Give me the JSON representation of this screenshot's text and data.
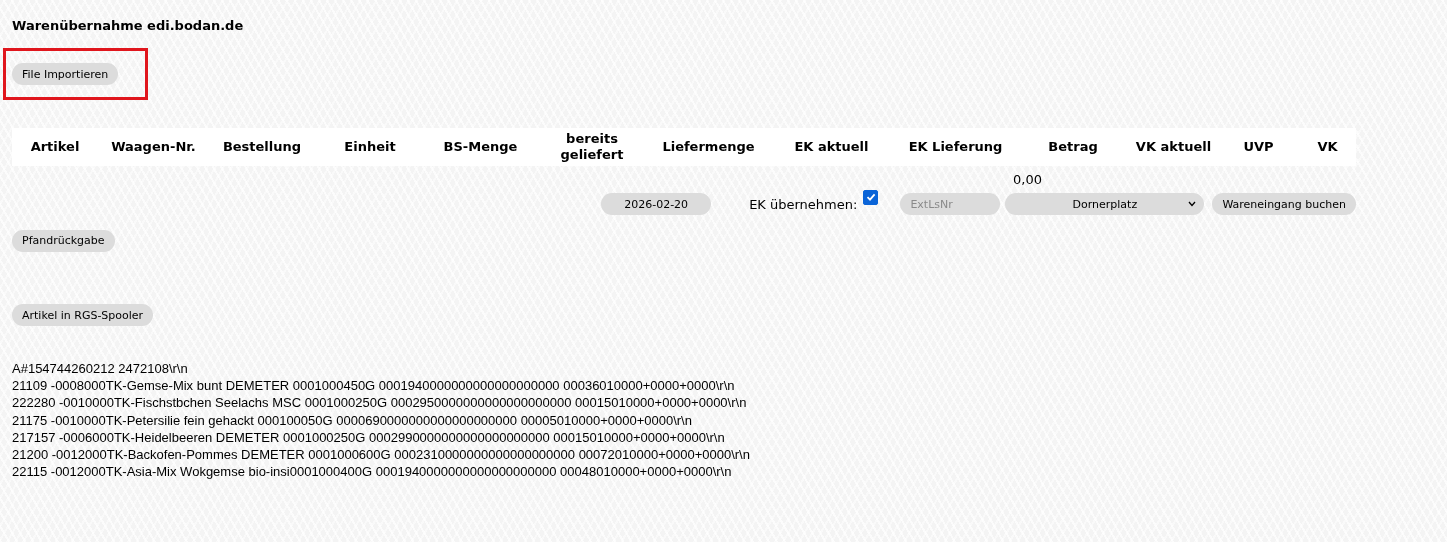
{
  "page": {
    "title": "Warenübernahme edi.bodan.de",
    "highlighted_button": "File Importieren"
  },
  "table": {
    "columns": [
      "Artikel",
      "Waagen-Nr.",
      "Bestellung",
      "Einheit",
      "BS-Menge",
      "bereits geliefert",
      "Liefermenge",
      "EK aktuell",
      "EK Lieferung",
      "Betrag",
      "VK aktuell",
      "UVP",
      "VK"
    ],
    "total": "0,00"
  },
  "booking": {
    "date": "2026-02-20",
    "ek_label": "EK übernehmen:",
    "ek_checked": true,
    "ext_ls_placeholder": "ExtLsNr",
    "location": "Dornerplatz",
    "submit": "Wareneingang buchen"
  },
  "buttons": [
    "Pfandrückgabe",
    "Artikel in RGS-Spooler"
  ],
  "file_lines": [
    "A#154744260212 2472108\\r\\n",
    "21109 -0008000TK-Gemse-Mix bunt DEMETER 0001000450G 0001940000000000000000000 00036010000+0000+0000\\r\\n",
    "222280 -0010000TK-Fischstbchen Seelachs MSC 0001000250G 0002950000000000000000000 00015010000+0000+0000\\r\\n",
    "21175 -0010000TK-Petersilie fein gehackt 000100050G 0000690000000000000000000 00005010000+0000+0000\\r\\n",
    "217157 -0006000TK-Heidelbeeren DEMETER 0001000250G 0002990000000000000000000 00015010000+0000+0000\\r\\n",
    "21200 -0012000TK-Backofen-Pommes DEMETER 0001000600G 0002310000000000000000000 00072010000+0000+0000\\r\\n",
    "22115 -0012000TK-Asia-Mix Wokgemse bio-insi0001000400G 0001940000000000000000000 00048010000+0000+0000\\r\\n"
  ]
}
